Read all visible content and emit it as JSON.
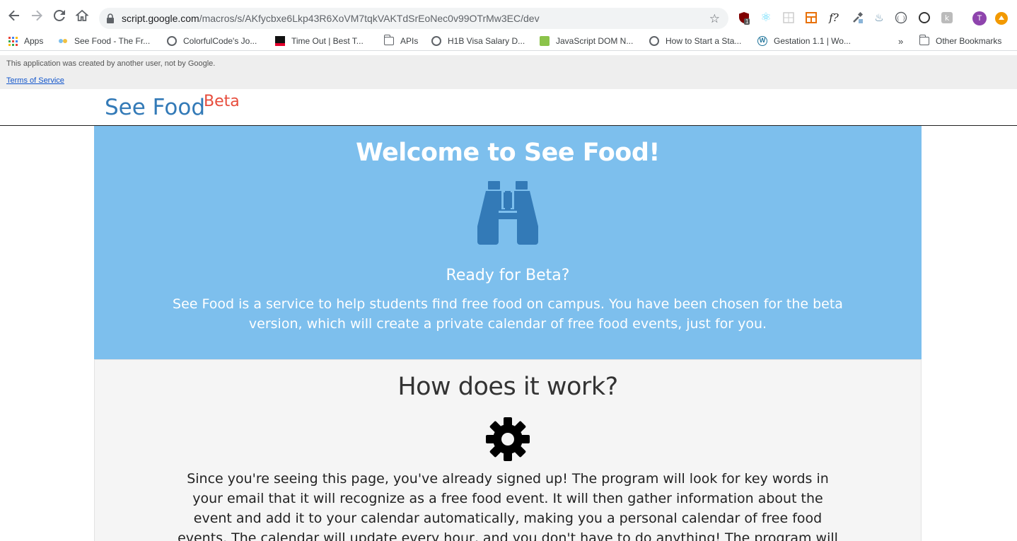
{
  "browser": {
    "url_host": "script.google.com",
    "url_path": "/macros/s/AKfycbxe6Lkp43R6XoVM7tqkVAKTdSrEoNec0v99OTrMw3EC/dev",
    "extension_badge": "1",
    "avatar_letter": "T",
    "bookmarks": [
      {
        "label": "Apps",
        "icon": "apps-grid-icon"
      },
      {
        "label": "See Food - The Fr...",
        "icon": "seefood-favicon"
      },
      {
        "label": "ColorfulCode's Jo...",
        "icon": "globe-icon"
      },
      {
        "label": "Time Out | Best T...",
        "icon": "timeout-favicon"
      },
      {
        "label": "APIs",
        "icon": "folder-icon"
      },
      {
        "label": "H1B Visa Salary D...",
        "icon": "globe-icon"
      },
      {
        "label": "JavaScript DOM N...",
        "icon": "javascript-favicon"
      },
      {
        "label": "How to Start a Sta...",
        "icon": "globe-icon"
      },
      {
        "label": "Gestation 1.1 | Wo...",
        "icon": "wordpress-icon"
      }
    ],
    "more_bookmarks": "»",
    "other_bookmarks": "Other Bookmarks"
  },
  "gas_banner": {
    "notice": "This application was created by another user, not by Google.",
    "terms_link": "Terms of Service"
  },
  "header": {
    "brand": "See Food",
    "beta": "Beta"
  },
  "hero": {
    "title": "Welcome to See Food!",
    "subtitle": "Ready for Beta?",
    "description": "See Food is a service to help students find free food on campus. You have been chosen for the beta version, which will create a private calendar of free food events, just for you."
  },
  "how": {
    "title": "How does it work?",
    "description": "Since you're seeing this page, you've already signed up! The program will look for key words in your email that it will recognize as a free food event. It will then gather information about the event and add it to your calendar automatically, making you a personal calendar of free food events. The calendar will update every hour, and you don't have to do anything! The program will run on its own, and you can"
  },
  "colors": {
    "hero_bg": "#7dbfed",
    "brand_blue": "#337ab7",
    "beta_red": "#e74c3c",
    "section_bg": "#f5f5f5"
  }
}
